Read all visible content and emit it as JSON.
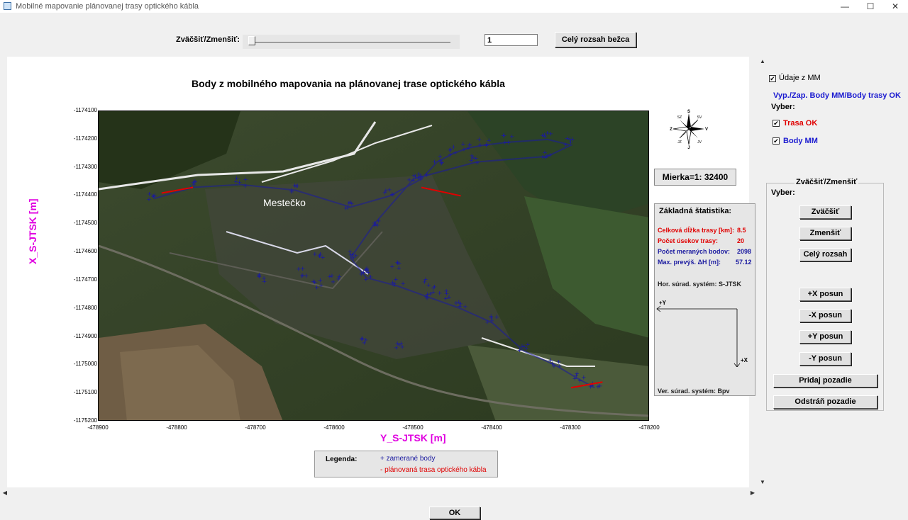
{
  "window": {
    "title": "Mobilné mapovanie plánovanej trasy optického kábla",
    "minimize": "—",
    "maximize": "☐",
    "close": "✕"
  },
  "toolbar": {
    "zoom_label": "Zväčšiť/Zmenšiť:",
    "zoom_value": "1",
    "full_range_button": "Celý rozsah bežca"
  },
  "plot": {
    "title": "Body z mobilného mapovania na plánovanej trase optického kábla",
    "place_label": "Mestečko",
    "scale": "Mierka=1: 32400"
  },
  "chart_data": {
    "type": "scatter",
    "xlabel": "Y_S-JTSK [m]",
    "ylabel": "X_S-JTSK [m]",
    "xlim": [
      -478900,
      -478200
    ],
    "ylim": [
      -1175200,
      -1174100
    ],
    "x_ticks": [
      "-478900",
      "-478800",
      "-478700",
      "-478600",
      "-478500",
      "-478400",
      "-478300",
      "-478200"
    ],
    "y_ticks": [
      "-1174100",
      "-1174200",
      "-1174300",
      "-1174400",
      "-1174500",
      "-1174600",
      "-1174700",
      "-1174800",
      "-1174900",
      "-1175000",
      "-1175100",
      "-1175200"
    ],
    "series": [
      {
        "name": "zamerané body",
        "color": "#1a1aa0",
        "marker": "+",
        "x": [
          -478830,
          -478780,
          -478720,
          -478650,
          -478580,
          -478530,
          -478490,
          -478470,
          -478450,
          -478430,
          -478410,
          -478380,
          -478330,
          -478300,
          -478330,
          -478420,
          -478500,
          -478550,
          -478580,
          -478560,
          -478520,
          -478480,
          -478440,
          -478400,
          -478360,
          -478320,
          -478290,
          -478270,
          -478620,
          -478640,
          -478600,
          -478560,
          -478520,
          -478480,
          -478460,
          -478620,
          -478690,
          -478560,
          -478520
        ],
        "y": [
          -1174410,
          -1174370,
          -1174360,
          -1174380,
          -1174440,
          -1174400,
          -1174340,
          -1174280,
          -1174250,
          -1174230,
          -1174220,
          -1174210,
          -1174200,
          -1174220,
          -1174260,
          -1174280,
          -1174340,
          -1174500,
          -1174620,
          -1174690,
          -1174720,
          -1174760,
          -1174800,
          -1174850,
          -1174950,
          -1175000,
          -1175050,
          -1175080,
          -1174620,
          -1174680,
          -1174700,
          -1174680,
          -1174660,
          -1174720,
          -1174760,
          -1174720,
          -1174700,
          -1174920,
          -1174940
        ]
      },
      {
        "name": "plánovaná trasa optického kábla",
        "color": "#e00000",
        "marker": "-",
        "x": [
          -478820,
          -478780,
          -478490,
          -478440,
          -478300,
          -478260
        ],
        "y": [
          -1174390,
          -1174370,
          -1174370,
          -1174400,
          -1175080,
          -1175060
        ]
      }
    ],
    "legend": "bottom-center",
    "grid": false
  },
  "compass": {
    "n": "S",
    "s": "J",
    "w": "Z",
    "e": "V",
    "nw": "SZ",
    "ne": "SV",
    "sw": "JZ",
    "se": "JV"
  },
  "stats": {
    "title": "Základná štatistika:",
    "rows": [
      {
        "label": "Celková dĺžka trasy [km]:",
        "value": "8.5",
        "color": "#e00000"
      },
      {
        "label": "Počet úsekov trasy:",
        "value": "20",
        "color": "#e00000"
      },
      {
        "label": "Počet meraných bodov:",
        "value": "2098",
        "color": "#1a1aa0"
      },
      {
        "label": "Max. prevýš. ΔH [m]:",
        "value": "57.12",
        "color": "#1a1aa0"
      }
    ],
    "hor_system": "Hor. súrad. systém: S-JTSK",
    "axis_y": "+Y",
    "axis_x": "+X",
    "ver_system": "Ver. súrad. systém: Bpv"
  },
  "legend": {
    "title": "Legenda:",
    "item1": "+ zamerané body",
    "item2": "- plánovaná trasa optického kábla"
  },
  "right_panel": {
    "mm_data": "Údaje z MM",
    "toggle_title": "Vyp./Zap. Body MM/Body trasy OK",
    "select_label": "Vyber:",
    "trasa_ok": "Trasa OK",
    "body_mm": "Body MM",
    "group_title": "Zväčšiť/Zmenšiť",
    "group_select": "Vyber:",
    "zoom_in": "Zväčšiť",
    "zoom_out": "Zmenšiť",
    "full_range": "Celý rozsah",
    "x_plus": "+X posun",
    "x_minus": "-X posun",
    "y_plus": "+Y posun",
    "y_minus": "-Y posun",
    "add_bg": "Pridaj pozadie",
    "remove_bg": "Odstráň pozadie"
  },
  "ok_button": "OK",
  "colors": {
    "axis_label": "#e000e0",
    "points": "#1a1aa0",
    "route": "#e00000"
  }
}
